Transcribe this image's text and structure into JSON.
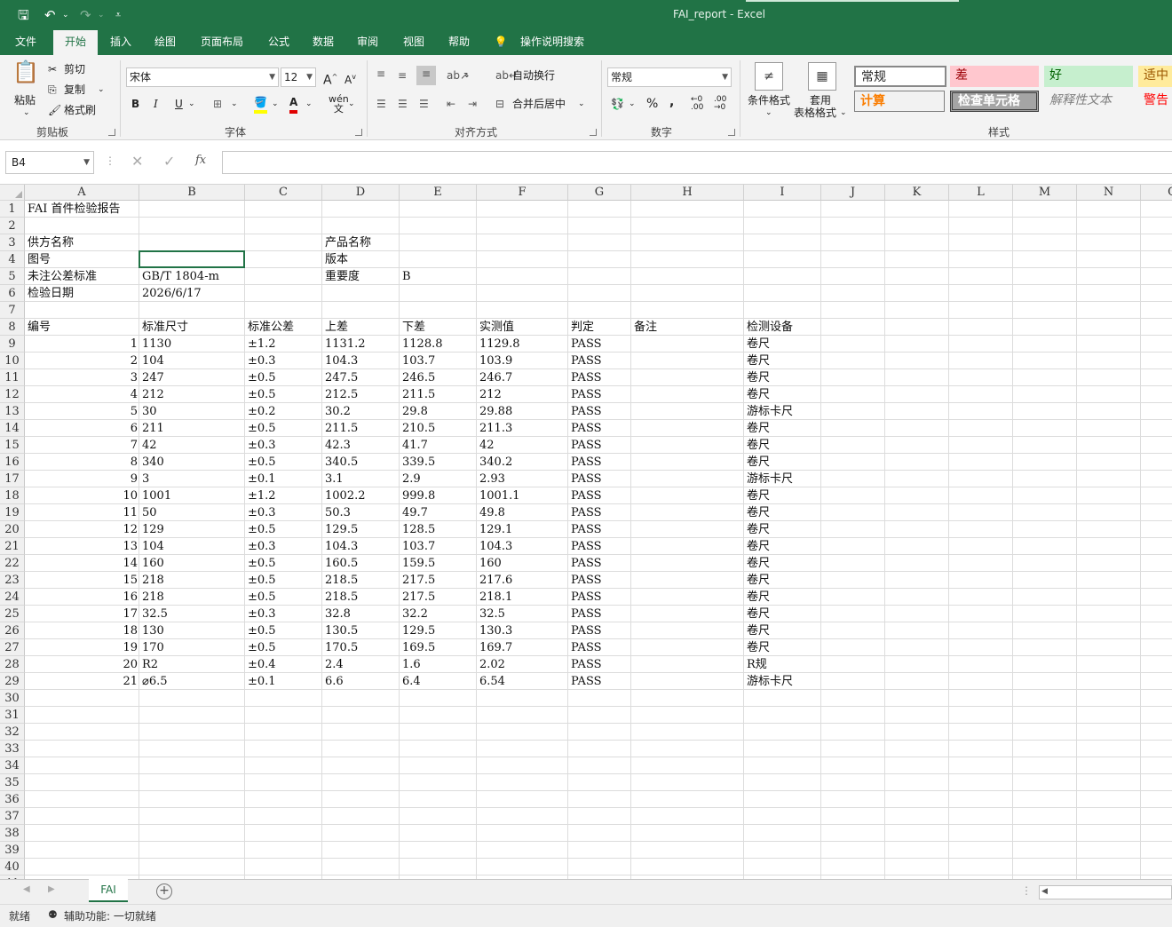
{
  "app": {
    "title": "FAI_report  -  Excel"
  },
  "ribbon_tabs": [
    {
      "label": "文件"
    },
    {
      "label": "开始"
    },
    {
      "label": "插入"
    },
    {
      "label": "绘图"
    },
    {
      "label": "页面布局"
    },
    {
      "label": "公式"
    },
    {
      "label": "数据"
    },
    {
      "label": "审阅"
    },
    {
      "label": "视图"
    },
    {
      "label": "帮助"
    },
    {
      "label": "操作说明搜索"
    }
  ],
  "clipboard": {
    "paste": "粘贴",
    "cut": "剪切",
    "copy": "复制",
    "format_painter": "格式刷",
    "label": "剪贴板"
  },
  "font": {
    "name": "宋体",
    "size": "12",
    "label": "字体"
  },
  "alignment": {
    "wrap_text": "自动换行",
    "merge_center": "合并后居中",
    "label": "对齐方式"
  },
  "number": {
    "format": "常规",
    "label": "数字"
  },
  "styles": {
    "conditional_format": "条件格式",
    "table_format_1": "套用",
    "table_format_2": "表格格式",
    "normal": "常规",
    "bad": "差",
    "good": "好",
    "neutral": "适中",
    "calc": "计算",
    "check_cell": "检查单元格",
    "explanatory": "解释性文本",
    "warning": "警告文",
    "label": "样式"
  },
  "formula_bar": {
    "name_box": "B4",
    "fx": "fx"
  },
  "columns": [
    "A",
    "B",
    "C",
    "D",
    "E",
    "F",
    "G",
    "H",
    "I",
    "J",
    "K",
    "L",
    "M",
    "N",
    "O"
  ],
  "sheet": {
    "title": "FAI 首件检验报告",
    "supplier_label": "供方名称",
    "drawing_label": "图号",
    "tolerance_std_label": "未注公差标准",
    "tolerance_std_value": "GB/T 1804-m",
    "inspect_date_label": "检验日期",
    "inspect_date_value": "2026/6/17",
    "product_label": "产品名称",
    "version_label": "版本",
    "importance_label": "重要度",
    "importance_value": "B",
    "headers": [
      "编号",
      "标准尺寸",
      "标准公差",
      "上差",
      "下差",
      "实测值",
      "判定",
      "备注",
      "检测设备"
    ],
    "rows": [
      [
        "1",
        "1130",
        "±1.2",
        "1131.2",
        "1128.8",
        "1129.8",
        "PASS",
        "",
        "卷尺"
      ],
      [
        "2",
        "104",
        "±0.3",
        "104.3",
        "103.7",
        "103.9",
        "PASS",
        "",
        "卷尺"
      ],
      [
        "3",
        "247",
        "±0.5",
        "247.5",
        "246.5",
        "246.7",
        "PASS",
        "",
        "卷尺"
      ],
      [
        "4",
        "212",
        "±0.5",
        "212.5",
        "211.5",
        "212",
        "PASS",
        "",
        "卷尺"
      ],
      [
        "5",
        "30",
        "±0.2",
        "30.2",
        "29.8",
        "29.88",
        "PASS",
        "",
        "游标卡尺"
      ],
      [
        "6",
        "211",
        "±0.5",
        "211.5",
        "210.5",
        "211.3",
        "PASS",
        "",
        "卷尺"
      ],
      [
        "7",
        "42",
        "±0.3",
        "42.3",
        "41.7",
        "42",
        "PASS",
        "",
        "卷尺"
      ],
      [
        "8",
        "340",
        "±0.5",
        "340.5",
        "339.5",
        "340.2",
        "PASS",
        "",
        "卷尺"
      ],
      [
        "9",
        "3",
        "±0.1",
        "3.1",
        "2.9",
        "2.93",
        "PASS",
        "",
        "游标卡尺"
      ],
      [
        "10",
        "1001",
        "±1.2",
        "1002.2",
        "999.8",
        "1001.1",
        "PASS",
        "",
        "卷尺"
      ],
      [
        "11",
        "50",
        "±0.3",
        "50.3",
        "49.7",
        "49.8",
        "PASS",
        "",
        "卷尺"
      ],
      [
        "12",
        "129",
        "±0.5",
        "129.5",
        "128.5",
        "129.1",
        "PASS",
        "",
        "卷尺"
      ],
      [
        "13",
        "104",
        "±0.3",
        "104.3",
        "103.7",
        "104.3",
        "PASS",
        "",
        "卷尺"
      ],
      [
        "14",
        "160",
        "±0.5",
        "160.5",
        "159.5",
        "160",
        "PASS",
        "",
        "卷尺"
      ],
      [
        "15",
        "218",
        "±0.5",
        "218.5",
        "217.5",
        "217.6",
        "PASS",
        "",
        "卷尺"
      ],
      [
        "16",
        "218",
        "±0.5",
        "218.5",
        "217.5",
        "218.1",
        "PASS",
        "",
        "卷尺"
      ],
      [
        "17",
        "32.5",
        "±0.3",
        "32.8",
        "32.2",
        "32.5",
        "PASS",
        "",
        "卷尺"
      ],
      [
        "18",
        "130",
        "±0.5",
        "130.5",
        "129.5",
        "130.3",
        "PASS",
        "",
        "卷尺"
      ],
      [
        "19",
        "170",
        "±0.5",
        "170.5",
        "169.5",
        "169.7",
        "PASS",
        "",
        "卷尺"
      ],
      [
        "20",
        "R2",
        "±0.4",
        "2.4",
        "1.6",
        "2.02",
        "PASS",
        "",
        "R规"
      ],
      [
        "21",
        "⌀6.5",
        "±0.1",
        "6.6",
        "6.4",
        "6.54",
        "PASS",
        "",
        "游标卡尺"
      ]
    ]
  },
  "sheet_tab": "FAI",
  "status": {
    "ready": "就绪",
    "accessibility": "辅助功能: 一切就绪"
  }
}
